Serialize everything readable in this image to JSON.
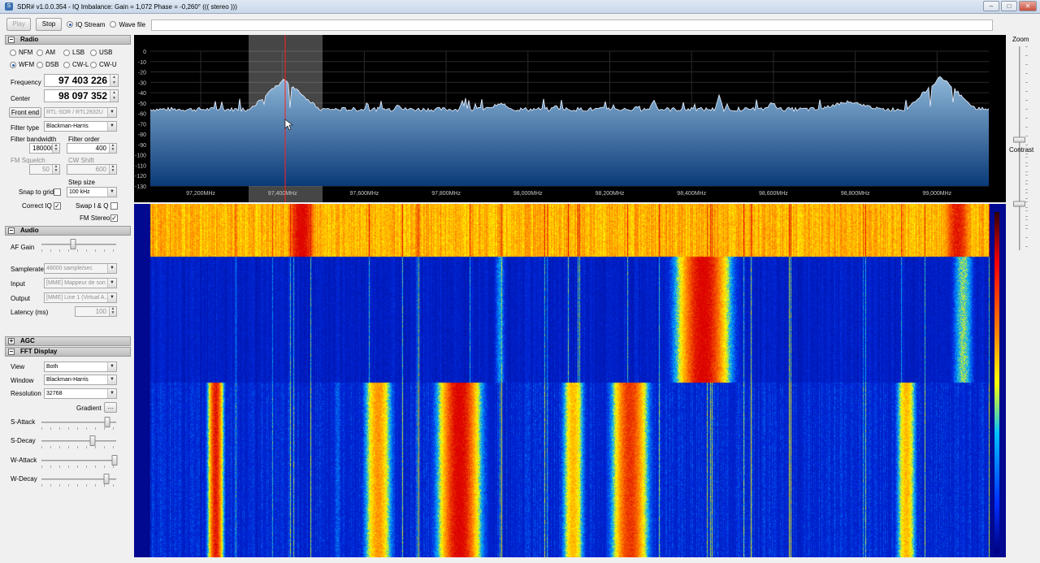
{
  "window": {
    "title": "SDR# v1.0.0.354 - IQ Imbalance: Gain = 1,072 Phase = -0,260° ((( stereo )))",
    "min_icon": "minimize-icon",
    "max_icon": "maximize-icon",
    "close_icon": "close-icon",
    "min_glyph": "–",
    "max_glyph": "□",
    "close_glyph": "✕"
  },
  "toolbar": {
    "play_label": "Play",
    "stop_label": "Stop",
    "iq_stream_label": "IQ Stream",
    "wave_file_label": "Wave file",
    "source_selected": "iq_stream"
  },
  "radio": {
    "section_title": "Radio",
    "modes": [
      "NFM",
      "AM",
      "LSB",
      "USB",
      "WFM",
      "DSB",
      "CW-L",
      "CW-U"
    ],
    "selected_mode": "WFM",
    "frequency_label": "Frequency",
    "frequency_value": "97 403 226",
    "center_label": "Center",
    "center_value": "98 097 352",
    "front_end_label": "Front end",
    "front_end_value": "RTL-SDR / RTL2832U",
    "filter_type_label": "Filter type",
    "filter_type_value": "Blackman-Harris",
    "filter_bandwidth_label": "Filter bandwidth",
    "filter_bandwidth_value": "180000",
    "filter_order_label": "Filter order",
    "filter_order_value": "400",
    "fm_squelch_label": "FM Squelch",
    "fm_squelch_value": "50",
    "cw_shift_label": "CW Shift",
    "cw_shift_value": "600",
    "step_size_label": "Step size",
    "step_size_value": "100 kHz",
    "snap_to_grid_label": "Snap to grid",
    "snap_to_grid_checked": false,
    "correct_iq_label": "Correct IQ",
    "correct_iq_checked": true,
    "swap_iq_label": "Swap I & Q",
    "swap_iq_checked": false,
    "fm_stereo_label": "FM Stereo",
    "fm_stereo_checked": true,
    "check_mark": "✓"
  },
  "audio": {
    "section_title": "Audio",
    "af_gain_label": "AF Gain",
    "af_gain_level": 0.42,
    "samplerate_label": "Samplerate",
    "samplerate_value": "48000 sample/sec",
    "input_label": "Input",
    "input_value": "[MME] Mappeur de son",
    "output_label": "Output",
    "output_value": "[MME] Line 1 (Virtual A...",
    "latency_label": "Latency (ms)",
    "latency_value": "100"
  },
  "agc": {
    "section_title": "AGC"
  },
  "fft": {
    "section_title": "FFT Display",
    "view_label": "View",
    "view_value": "Both",
    "window_label": "Window",
    "window_value": "Blackman-Harris",
    "resolution_label": "Resolution",
    "resolution_value": "32768",
    "gradient_label": "Gradient",
    "gradient_button": "...",
    "s_attack_label": "S-Attack",
    "s_attack_level": 0.88,
    "s_decay_label": "S-Decay",
    "s_decay_level": 0.68,
    "w_attack_label": "W-Attack",
    "w_attack_level": 0.98,
    "w_decay_label": "W-Decay",
    "w_decay_level": 0.87,
    "expand_glyph": "+",
    "collapse_glyph": "–"
  },
  "right": {
    "zoom_label": "Zoom",
    "zoom_level": 0.5,
    "contrast_label": "Contrast",
    "contrast_level": 0.5
  },
  "spectrum": {
    "db_labels": [
      "0",
      "-10",
      "-20",
      "-30",
      "-40",
      "-50",
      "-60",
      "-70",
      "-80",
      "-90",
      "-100",
      "-110",
      "-120",
      "-130"
    ],
    "freq_labels": [
      "97,200MHz",
      "97,400MHz",
      "97,600MHz",
      "97,800MHz",
      "98,000MHz",
      "98,200MHz",
      "98,400MHz",
      "98,600MHz",
      "98,800MHz",
      "99,000MHz"
    ],
    "colors": {
      "fill_top": "#8fb8d8",
      "fill_bottom": "#0a3a78",
      "trace": "#e8f0ff",
      "cursor": "#ff2020",
      "grid": "#2a2a2a"
    }
  }
}
